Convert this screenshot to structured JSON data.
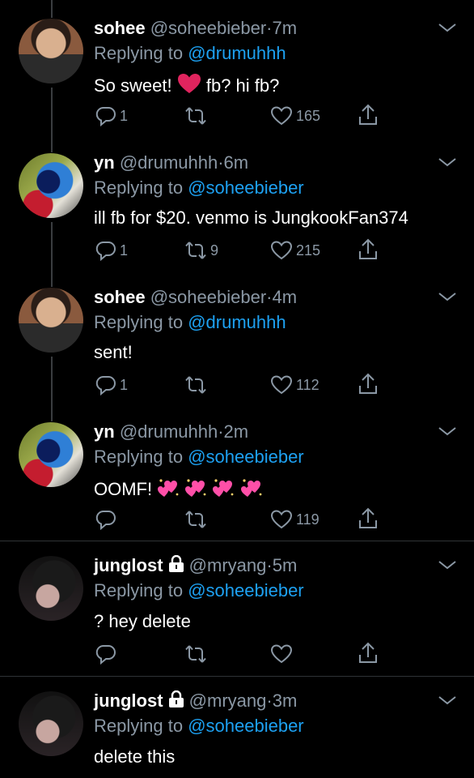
{
  "tweets": [
    {
      "name": "sohee",
      "handle": "@soheebieber",
      "time": "7m",
      "reply_prefix": "Replying to",
      "reply_to": "@drumuhhh",
      "text_a": "So sweet!",
      "text_b": "fb? hi fb?",
      "reply_count": "1",
      "retweet_count": "",
      "like_count": "165",
      "avatar_icon": "sohee-avatar"
    },
    {
      "name": "yn",
      "handle": "@drumuhhh",
      "time": "6m",
      "reply_prefix": "Replying to",
      "reply_to": "@soheebieber",
      "text": "ill fb for $20. venmo is JungkookFan374",
      "reply_count": "1",
      "retweet_count": "9",
      "like_count": "215",
      "avatar_icon": "yn-avatar"
    },
    {
      "name": "sohee",
      "handle": "@soheebieber",
      "time": "4m",
      "reply_prefix": "Replying to",
      "reply_to": "@drumuhhh",
      "text": "sent!",
      "reply_count": "1",
      "retweet_count": "",
      "like_count": "112",
      "avatar_icon": "sohee-avatar"
    },
    {
      "name": "yn",
      "handle": "@drumuhhh",
      "time": "2m",
      "reply_prefix": "Replying to",
      "reply_to": "@soheebieber",
      "text": "OOMF!",
      "reply_count": "",
      "retweet_count": "",
      "like_count": "119",
      "avatar_icon": "yn-avatar"
    },
    {
      "name": "junglost",
      "handle": "@mryang",
      "time": "5m",
      "reply_prefix": "Replying to",
      "reply_to": "@soheebieber",
      "text": "? hey delete",
      "reply_count": "",
      "retweet_count": "",
      "like_count": "",
      "avatar_icon": "junglost-avatar"
    },
    {
      "name": "junglost",
      "handle": "@mryang",
      "time": "3m",
      "reply_prefix": "Replying to",
      "reply_to": "@soheebieber",
      "text": "delete this",
      "avatar_icon": "junglost-avatar"
    }
  ],
  "colors": {
    "accent": "#1da1f2",
    "muted": "#8b98a5",
    "heart": "#e0245e",
    "sparkle_heart": "#ff4fa8"
  }
}
